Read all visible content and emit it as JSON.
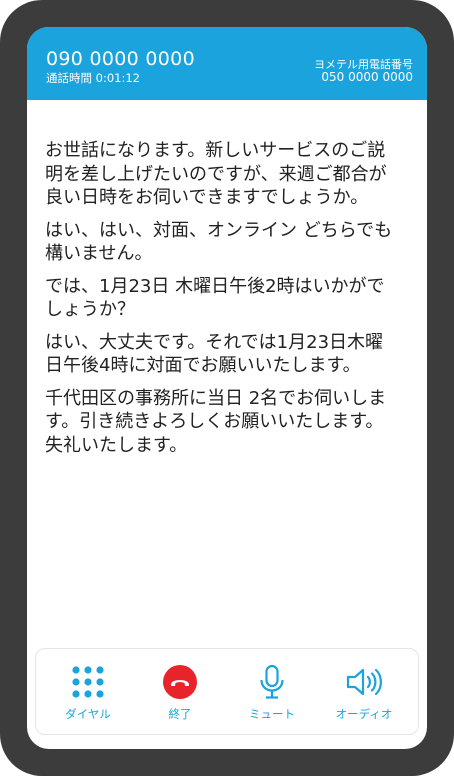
{
  "header": {
    "caller_number": "090 0000 0000",
    "call_duration": "通話時間 0:01:12",
    "line_label": "ヨメテル用電話番号",
    "line_number": "050 0000 0000"
  },
  "transcript": [
    "お世話になります。新しいサービスのご説明を差し上げたいのですが、来週ご都合が良い日時をお伺いできますでしょうか。",
    "はい、はい、対面、オンライン どちらでも構いません。",
    "では、1月23日 木曜日午後2時はいかがでしょうか？",
    "はい、大丈夫です。それでは1月23日木曜日午後4時に対面でお願いいたします。",
    "千代田区の事務所に当日 2名でお伺いします。引き続きよろしくお願いいたします。失礼いたします。"
  ],
  "controls": {
    "dial": {
      "label": "ダイヤル",
      "icon": "keypad-icon"
    },
    "end": {
      "label": "終了",
      "icon": "hang-up-icon"
    },
    "mute": {
      "label": "ミュート",
      "icon": "microphone-icon"
    },
    "audio": {
      "label": "オーディオ",
      "icon": "speaker-icon"
    }
  },
  "colors": {
    "accent": "#1aa3dc",
    "end_call": "#e8242b",
    "frame": "#3c3c3c"
  }
}
